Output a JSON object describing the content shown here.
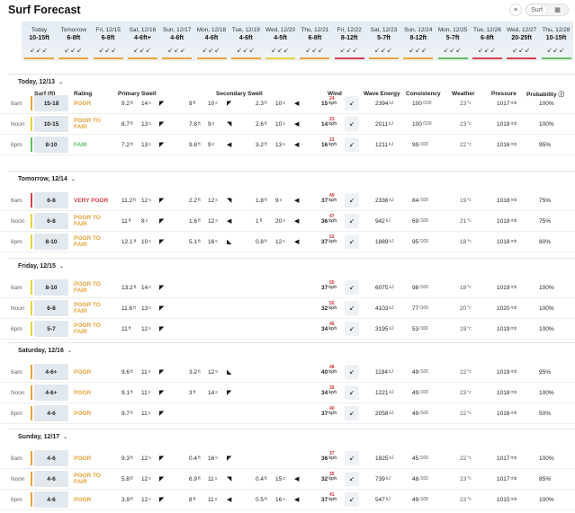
{
  "title": "Surf Forecast",
  "view_toggle": {
    "list_icon": "≡",
    "surf_label": "Surf",
    "table_icon": "▦"
  },
  "strip": [
    {
      "day": "Today",
      "height": "10-15ft",
      "color": "#e8a33a"
    },
    {
      "day": "Tomorrow",
      "height": "6-8ft",
      "color": "#e8a33a"
    },
    {
      "day": "Fri, 12/15",
      "height": "6-8ft",
      "color": "#e8a33a"
    },
    {
      "day": "Sat, 12/16",
      "height": "4-6ft+",
      "color": "#e8a33a"
    },
    {
      "day": "Sun, 12/17",
      "height": "4-6ft",
      "color": "#e8a33a"
    },
    {
      "day": "Mon, 12/18",
      "height": "4-6ft",
      "color": "#e8a33a"
    },
    {
      "day": "Tue, 12/19",
      "height": "4-6ft",
      "color": "#e8a33a"
    },
    {
      "day": "Wed, 12/20",
      "height": "4-5ft",
      "color": "#e8d23a"
    },
    {
      "day": "Thu, 12/21",
      "height": "6-8ft",
      "color": "#e8a33a"
    },
    {
      "day": "Fri, 12/22",
      "height": "8-12ft",
      "color": "#d6404a"
    },
    {
      "day": "Sat, 12/23",
      "height": "5-7ft",
      "color": "#e8a33a"
    },
    {
      "day": "Sun, 12/24",
      "height": "8-12ft",
      "color": "#e8a33a"
    },
    {
      "day": "Mon, 12/25",
      "height": "5-7ft",
      "color": "#5cbf5c"
    },
    {
      "day": "Tue, 12/26",
      "height": "6-8ft",
      "color": "#d6404a"
    },
    {
      "day": "Wed, 12/27",
      "height": "20-25ft",
      "color": "#d6404a"
    },
    {
      "day": "Thu, 12/28",
      "height": "10-15ft",
      "color": "#5cbf5c"
    }
  ],
  "columns": {
    "surf": "Surf (ft)",
    "rating": "Rating",
    "primary": "Primary Swell",
    "secondary": "Secondary Swell",
    "wind": "Wind",
    "energy": "Wave Energy",
    "consistency": "Consistency",
    "weather": "Weather",
    "pressure": "Pressure",
    "probability": "Probability ⓘ"
  },
  "units": {
    "ft": "ft",
    "s": "s",
    "kph": "kph",
    "kj": "kJ",
    "mb": "mb",
    "c": "°c",
    "cons": "/100"
  },
  "days": [
    {
      "label": "Today, 12/13",
      "rows": [
        {
          "time": "6am",
          "surf": "15-18",
          "rating": "POOR",
          "rcolor": "#e8a33a",
          "bar": "#e8a33a",
          "p": [
            "9.2",
            "14"
          ],
          "s1": [
            "9",
            "10"
          ],
          "s2": [
            "2.3",
            "10"
          ],
          "wind": "15",
          "gust": "24",
          "energy": "2394",
          "cons": "100",
          "weather": "23",
          "press": "1017",
          "prob": "100%"
        },
        {
          "time": "Noon",
          "surf": "10-15",
          "rating": "POOR TO FAIR",
          "rcolor": "#e8a33a",
          "bar": "#e8d23a",
          "p": [
            "8.7",
            "13"
          ],
          "s1": [
            "7.8",
            "9"
          ],
          "s2": [
            "2.6",
            "10"
          ],
          "wind": "14",
          "gust": "23",
          "energy": "2011",
          "cons": "100",
          "weather": "23",
          "press": "1018",
          "prob": "100%"
        },
        {
          "time": "6pm",
          "surf": "8-10",
          "rating": "FAIR",
          "rcolor": "#5cbf5c",
          "bar": "#5cbf5c",
          "p": [
            "7.2",
            "13"
          ],
          "s1": [
            "9.8",
            "9"
          ],
          "s2": [
            "3.2",
            "13"
          ],
          "wind": "16",
          "gust": "23",
          "energy": "1211",
          "cons": "99",
          "weather": "22",
          "press": "1016",
          "prob": "95%"
        }
      ]
    },
    {
      "label": "Tomorrow, 12/14",
      "rows": [
        {
          "time": "6am",
          "surf": "6-8",
          "rating": "VERY POOR",
          "rcolor": "#d6404a",
          "bar": "#d6404a",
          "p": [
            "11.2",
            "12"
          ],
          "s1": [
            "2.2",
            "12"
          ],
          "s2": [
            "1.8",
            "9"
          ],
          "wind": "37",
          "gust": "49",
          "energy": "2336",
          "cons": "84",
          "weather": "19",
          "press": "1018",
          "prob": "75%"
        },
        {
          "time": "Noon",
          "surf": "6-8",
          "rating": "POOR TO FAIR",
          "rcolor": "#e8a33a",
          "bar": "#e8d23a",
          "p": [
            "11",
            "8"
          ],
          "s1": [
            "1.6",
            "12"
          ],
          "s2": [
            "1",
            "20"
          ],
          "wind": "36",
          "gust": "47",
          "energy": "942",
          "cons": "69",
          "weather": "21",
          "press": "1018",
          "prob": "75%"
        },
        {
          "time": "6pm",
          "surf": "8-10",
          "rating": "POOR TO FAIR",
          "rcolor": "#e8a33a",
          "bar": "#e8d23a",
          "p": [
            "12.1",
            "10"
          ],
          "s1": [
            "5.1",
            "16"
          ],
          "s2": [
            "0.8",
            "12"
          ],
          "wind": "37",
          "gust": "53",
          "energy": "1889",
          "cons": "95",
          "weather": "18",
          "press": "1018",
          "prob": "80%"
        }
      ]
    },
    {
      "label": "Friday, 12/15",
      "rows": [
        {
          "time": "6am",
          "surf": "8-10",
          "rating": "POOR TO FAIR",
          "rcolor": "#e8a33a",
          "bar": "#e8d23a",
          "p": [
            "13.2",
            "14"
          ],
          "s1": null,
          "s2": null,
          "wind": "37",
          "gust": "55",
          "energy": "6075",
          "cons": "98",
          "weather": "18",
          "press": "1019",
          "prob": "100%"
        },
        {
          "time": "Noon",
          "surf": "6-8",
          "rating": "POOR TO FAIR",
          "rcolor": "#e8a33a",
          "bar": "#e8d23a",
          "p": [
            "11.6",
            "13"
          ],
          "s1": null,
          "s2": null,
          "wind": "32",
          "gust": "50",
          "energy": "4103",
          "cons": "77",
          "weather": "20",
          "press": "1020",
          "prob": "100%"
        },
        {
          "time": "6pm",
          "surf": "5-7",
          "rating": "POOR TO FAIR",
          "rcolor": "#e8a33a",
          "bar": "#e8d23a",
          "p": [
            "11",
            "12"
          ],
          "s1": null,
          "s2": null,
          "wind": "34",
          "gust": "45",
          "energy": "3195",
          "cons": "53",
          "weather": "19",
          "press": "1019",
          "prob": "100%"
        }
      ]
    },
    {
      "label": "Saturday, 12/16",
      "rows": [
        {
          "time": "6am",
          "surf": "4-6+",
          "rating": "POOR",
          "rcolor": "#e8a33a",
          "bar": "#e8a33a",
          "p": [
            "9.6",
            "11"
          ],
          "s1": [
            "3.2",
            "12"
          ],
          "s2": null,
          "wind": "40",
          "gust": "48",
          "energy": "1194",
          "cons": "49",
          "weather": "22",
          "press": "1019",
          "prob": "95%"
        },
        {
          "time": "Noon",
          "surf": "4-6+",
          "rating": "POOR",
          "rcolor": "#e8a33a",
          "bar": "#e8a33a",
          "p": [
            "9.1",
            "11"
          ],
          "s1": [
            "3",
            "14"
          ],
          "s2": null,
          "wind": "34",
          "gust": "39",
          "energy": "1221",
          "cons": "49",
          "weather": "23",
          "press": "1018",
          "prob": "100%"
        },
        {
          "time": "6pm",
          "surf": "4-6",
          "rating": "POOR",
          "rcolor": "#e8a33a",
          "bar": "#e8a33a",
          "p": [
            "9.7",
            "11"
          ],
          "s1": null,
          "s2": null,
          "wind": "37",
          "gust": "40",
          "energy": "2058",
          "cons": "49",
          "weather": "22",
          "press": "1016",
          "prob": "50%"
        }
      ]
    },
    {
      "label": "Sunday, 12/17",
      "rows": [
        {
          "time": "6am",
          "surf": "4-6",
          "rating": "POOR",
          "rcolor": "#e8a33a",
          "bar": "#e8a33a",
          "p": [
            "9.3",
            "12"
          ],
          "s1": [
            "0.4",
            "16"
          ],
          "s2": null,
          "wind": "36",
          "gust": "37",
          "energy": "1825",
          "cons": "45",
          "weather": "22",
          "press": "1017",
          "prob": "100%"
        },
        {
          "time": "Noon",
          "surf": "4-6",
          "rating": "POOR TO FAIR",
          "rcolor": "#e8a33a",
          "bar": "#e8a33a",
          "p": [
            "5.8",
            "12"
          ],
          "s1": [
            "6.9",
            "11"
          ],
          "s2": [
            "0.4",
            "15"
          ],
          "wind": "32",
          "gust": "35",
          "energy": "739",
          "cons": "48",
          "weather": "23",
          "press": "1017",
          "prob": "85%"
        },
        {
          "time": "6pm",
          "surf": "4-6",
          "rating": "POOR",
          "rcolor": "#e8a33a",
          "bar": "#e8a33a",
          "p": [
            "3.9",
            "12"
          ],
          "s1": [
            "8",
            "11"
          ],
          "s2": [
            "0.5",
            "16"
          ],
          "wind": "37",
          "gust": "41",
          "energy": "547",
          "cons": "49",
          "weather": "23",
          "press": "1015",
          "prob": "100%"
        }
      ]
    }
  ]
}
